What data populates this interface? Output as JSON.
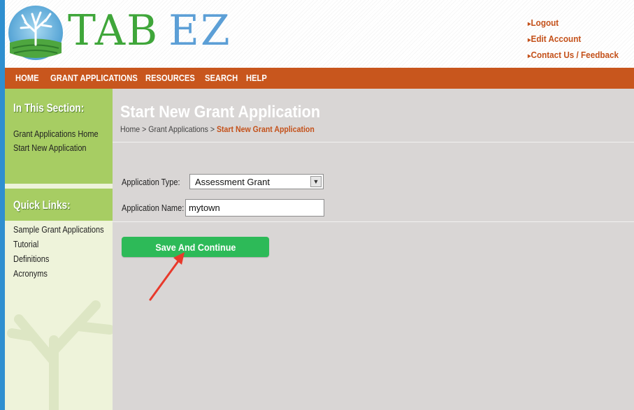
{
  "logo": {
    "part1": "TAB",
    "part2": "EZ"
  },
  "account_links": [
    {
      "label": "Logout"
    },
    {
      "label": "Edit Account"
    },
    {
      "label": "Contact Us / Feedback"
    }
  ],
  "nav": [
    {
      "label": "HOME"
    },
    {
      "label": "GRANT APPLICATIONS"
    },
    {
      "label": "RESOURCES"
    },
    {
      "label": "SEARCH"
    },
    {
      "label": "HELP"
    }
  ],
  "sidebar": {
    "section_title": "In This Section:",
    "section_links": [
      {
        "label": "Grant Applications Home"
      },
      {
        "label": "Start New Application"
      }
    ],
    "quick_title": "Quick Links:",
    "quick_links": [
      {
        "label": "Sample Grant Applications"
      },
      {
        "label": "Tutorial"
      },
      {
        "label": "Definitions"
      },
      {
        "label": "Acronyms"
      }
    ]
  },
  "main": {
    "title": "Start New Grant Application",
    "breadcrumb": {
      "home": "Home",
      "separator": ">",
      "section": "Grant Applications",
      "current": "Start New Grant Application"
    },
    "form": {
      "type_label": "Application Type:",
      "type_value": "Assessment Grant",
      "name_label": "Application Name:",
      "name_value": "mytown",
      "submit_label": "Save And Continue"
    }
  },
  "colors": {
    "nav_bg": "#c8561d",
    "accent_link": "#c4511a",
    "sidebar_header": "#a7cd63",
    "button_green": "#2dba58",
    "annotation_arrow": "#e8392b"
  },
  "icons": {
    "logo": "tree-icon",
    "annotation": "red-arrow-annotation"
  }
}
